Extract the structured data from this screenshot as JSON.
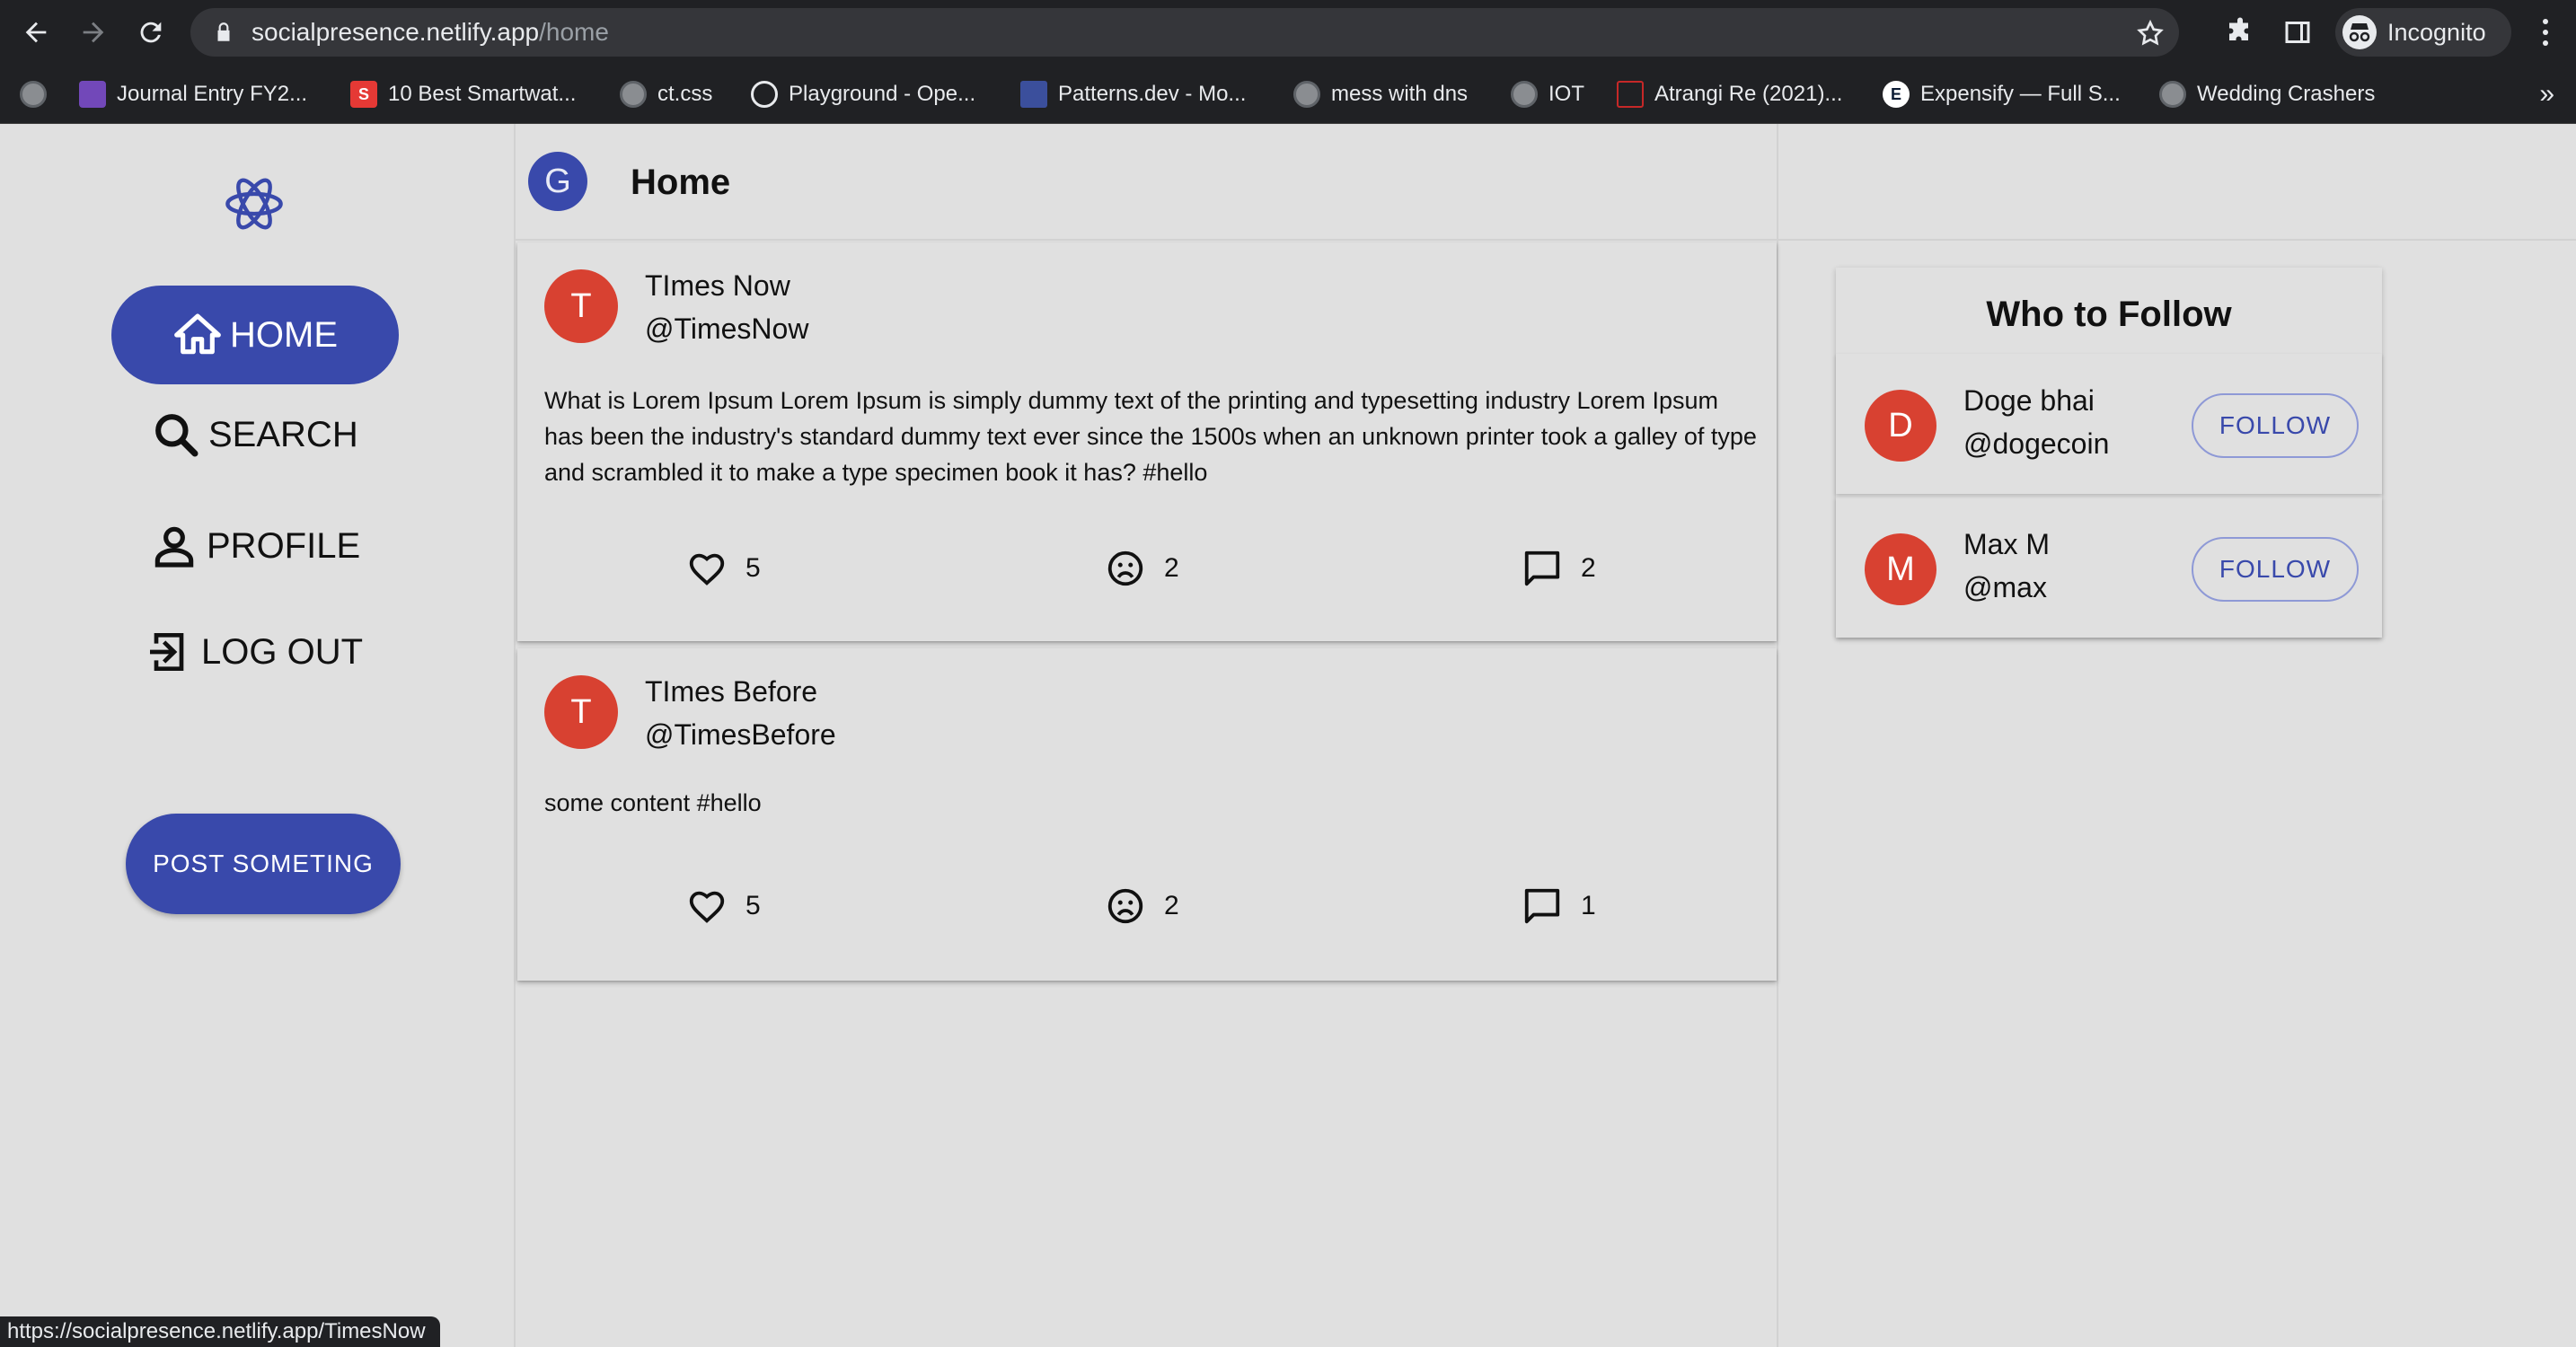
{
  "browser": {
    "url_host": "socialpresence.netlify.app",
    "url_path": "/home",
    "profile_label": "Incognito",
    "bookmarks": [
      {
        "label": "Journal Entry FY2...",
        "icon": "sheets-icon",
        "color": "#7248b9"
      },
      {
        "label": "10 Best Smartwat...",
        "icon": "red-s-icon",
        "color": "#e53935"
      },
      {
        "label": "ct.css",
        "icon": "globe-icon"
      },
      {
        "label": "Playground - Ope...",
        "icon": "openai-icon"
      },
      {
        "label": "Patterns.dev - Mo...",
        "icon": "patterns-icon"
      },
      {
        "label": "mess with dns",
        "icon": "globe-icon"
      },
      {
        "label": "IOT",
        "icon": "globe-icon"
      },
      {
        "label": "Atrangi Re (2021)...",
        "icon": "movie-icon",
        "color": "#c62828"
      },
      {
        "label": "Expensify — Full S...",
        "icon": "expensify-icon",
        "color": "#f2c94c"
      },
      {
        "label": "Wedding Crashers",
        "icon": "globe-icon"
      }
    ],
    "more_label": "»",
    "status_url": "https://socialpresence.netlify.app/TimesNow"
  },
  "sidebar": {
    "logo_icon": "redux-logo-icon",
    "items": [
      {
        "label": "HOME",
        "icon": "home-icon",
        "active": true
      },
      {
        "label": "SEARCH",
        "icon": "search-icon"
      },
      {
        "label": "PROFILE",
        "icon": "person-icon"
      },
      {
        "label": "LOG OUT",
        "icon": "logout-icon"
      }
    ],
    "post_button": "POST SOMETING"
  },
  "feed": {
    "user_initial": "G",
    "title": "Home",
    "theme_icon": "moon-icon",
    "posts": [
      {
        "initial": "T",
        "name": "TImes Now",
        "handle": "@TimesNow",
        "content": "What is Lorem Ipsum Lorem Ipsum is simply dummy text of the printing and typesetting industry Lorem Ipsum has been the industry's standard dummy text ever since the 1500s when an unknown printer took a galley of type and scrambled it to make a type specimen book it has? #hello",
        "likes": "5",
        "dislikes": "2",
        "comments": "2"
      },
      {
        "initial": "T",
        "name": "TImes Before",
        "handle": "@TimesBefore",
        "content": "some content #hello",
        "likes": "5",
        "dislikes": "2",
        "comments": "1"
      }
    ]
  },
  "who_to_follow": {
    "title": "Who to Follow",
    "users": [
      {
        "initial": "D",
        "name": "Doge bhai",
        "handle": "@dogecoin",
        "button": "FOLLOW"
      },
      {
        "initial": "M",
        "name": "Max M",
        "handle": "@max",
        "button": "FOLLOW"
      }
    ]
  },
  "colors": {
    "accent": "#3949ab",
    "avatar": "#d84131",
    "background": "#e0e0e0",
    "chrome": "#202124"
  }
}
